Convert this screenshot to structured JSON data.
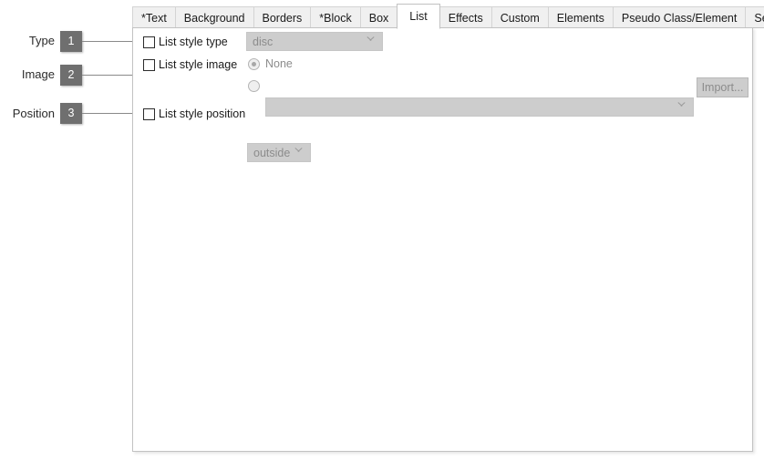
{
  "annotations": [
    {
      "label": "Type",
      "number": "1"
    },
    {
      "label": "Image",
      "number": "2"
    },
    {
      "label": "Position",
      "number": "3"
    }
  ],
  "tabs": [
    {
      "label": "*Text",
      "active": false
    },
    {
      "label": "Background",
      "active": false
    },
    {
      "label": "Borders",
      "active": false
    },
    {
      "label": "*Block",
      "active": false
    },
    {
      "label": "Box",
      "active": false
    },
    {
      "label": "List",
      "active": true
    },
    {
      "label": "Effects",
      "active": false
    },
    {
      "label": "Custom",
      "active": false
    },
    {
      "label": "Elements",
      "active": false
    },
    {
      "label": "Pseudo Class/Element",
      "active": false
    },
    {
      "label": "Selectors",
      "active": false
    }
  ],
  "form": {
    "list_style_type": {
      "checkbox_label": "List style type",
      "checked": false,
      "value": "disc",
      "disabled": true
    },
    "list_style_image": {
      "checkbox_label": "List style image",
      "checked": false,
      "none_radio_label": "None",
      "none_selected": true,
      "url_value": "",
      "url_placeholder": "",
      "import_button_label": "Import...",
      "disabled": true
    },
    "list_style_position": {
      "checkbox_label": "List style position",
      "checked": false,
      "value": "outside",
      "disabled": true
    }
  },
  "colors": {
    "badge_background": "#6f6f6f",
    "badge_text": "#ffffff",
    "panel_background": "#ffffff",
    "tab_inactive_background": "#f0f0f0",
    "disabled_control_background": "#cdcdcd",
    "disabled_text": "#8c8c8c"
  }
}
